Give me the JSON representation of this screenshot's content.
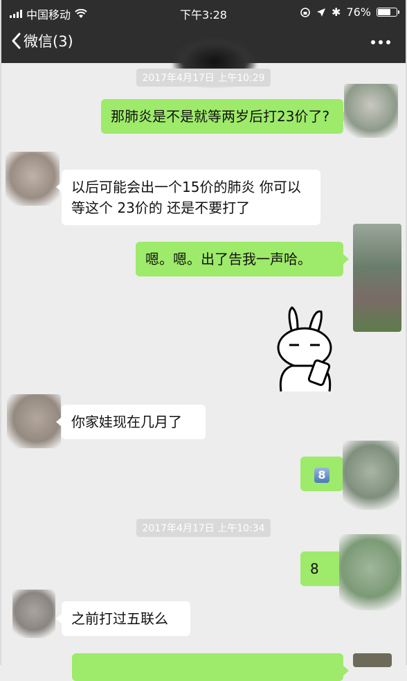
{
  "status_bar": {
    "carrier": "中国移动",
    "time": "下午3:28",
    "battery": "76%",
    "battery_level": 0.76
  },
  "nav": {
    "back_label": "微信(3)"
  },
  "messages": [
    {
      "type": "time",
      "text": "2017年4月17日 上午10:29"
    },
    {
      "type": "out",
      "text": "那肺炎是不是就等两岁后打23价了?"
    },
    {
      "type": "in",
      "text": "以后可能会出一个15价的肺炎 你可以等这个 23价的 还是不要打了"
    },
    {
      "type": "out",
      "text": "嗯。嗯。出了告我一声哈。"
    },
    {
      "type": "out_sticker",
      "sticker": "rabbit-sticker"
    },
    {
      "type": "in",
      "text": "你家娃现在几月了"
    },
    {
      "type": "out",
      "text": "8",
      "emoji": "keycap-8"
    },
    {
      "type": "time",
      "text": "2017年4月17日 上午10:34"
    },
    {
      "type": "out",
      "text": "8"
    },
    {
      "type": "in",
      "text": "之前打过五联么"
    },
    {
      "type": "out",
      "text": ""
    }
  ],
  "colors": {
    "nav_bg": "#2e2e2e",
    "chat_bg": "#ededed",
    "outgoing_bubble": "#9eea6a",
    "incoming_bubble": "#ffffff"
  }
}
